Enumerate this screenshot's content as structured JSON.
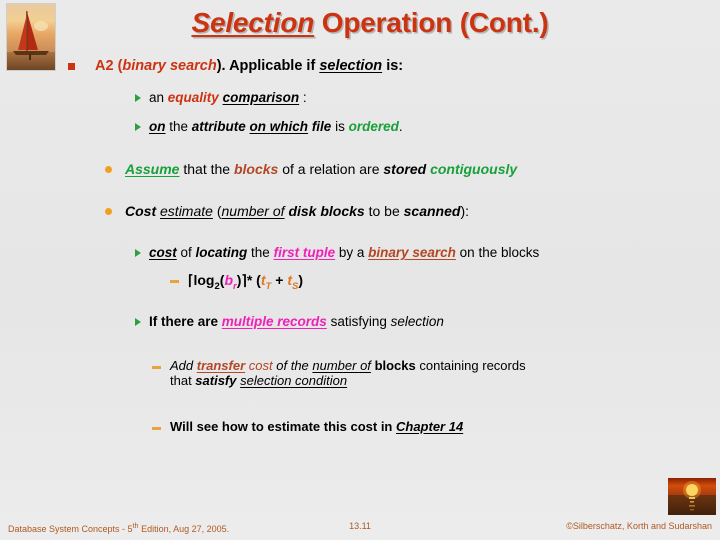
{
  "slide": {
    "title_italic": "Selection",
    "title_rest": " Operation (Cont.)",
    "title_full": "Selection Operation (Cont.)",
    "accent_red": "#cc3311",
    "accent_green": "#18a03a",
    "accent_orange": "#e07820",
    "accent_magenta": "#f020b8",
    "background": "#e8e8e8"
  },
  "content": {
    "a2_line": {
      "part1": "A2 (",
      "part2": "binary search",
      "part3": "). Applicable if ",
      "part4": "selection",
      "part5": " is:"
    },
    "sub1": {
      "part1": "an ",
      "part2": "equality",
      "part3": " ",
      "part4": "comparison",
      "part5": " :"
    },
    "sub2": {
      "part1": "on",
      "part2": " the ",
      "part3": "attribute",
      "part4": " ",
      "part5": "on which",
      "part6": " ",
      "part7": "file",
      "part8": " is ",
      "part9": "ordered",
      "part10": "."
    },
    "assume": {
      "part1": "Assume",
      "part2": " that the ",
      "part3": "blocks",
      "part4": " of a relation are ",
      "part5": "stored",
      "part6": " ",
      "part7": "contiguously"
    },
    "cost_estimate": {
      "part1": "Cost",
      "part2": " ",
      "part3": "estimate",
      "part4": " (",
      "part5": "number of",
      "part6": " ",
      "part7": "disk blocks",
      "part8": " to be ",
      "part9": "scanned",
      "part10": "):"
    },
    "cost_locating": {
      "part1": "cost",
      "part2": " of ",
      "part3": "locating",
      "part4": " the ",
      "part5": "first tuple",
      "part6": " by a ",
      "part7": "binary search",
      "part8": " on the blocks"
    },
    "formula": {
      "open_ceil": "⌈",
      "log": "log",
      "base": "2",
      "paren_open": "(",
      "var_b": "b",
      "var_b_sub": "r",
      "paren_close": ")",
      "close_ceil": "⌉",
      "times": "* (",
      "var_t1": "t",
      "var_t1_sub": "T",
      "plus": " + ",
      "var_t2": "t",
      "var_t2_sub": "S",
      "tail": ")",
      "plain": "⌈log2(br)⌉* (tT + tS)"
    },
    "multiple_records": {
      "part1": "If there are ",
      "part2": "multiple records",
      "part3": " satisfying ",
      "part4": "selection"
    },
    "add_transfer": {
      "part1": "Add ",
      "part2": "transfer",
      "part3": " ",
      "part4": "cost",
      "part5": "  of the ",
      "part6": "number of",
      "part7": " ",
      "part8": "blocks",
      "part9": " containing records",
      "line2_part1": "that ",
      "line2_part2": "satisfy",
      "line2_part3": " ",
      "line2_part4": "selection condition"
    },
    "chapter_ref": {
      "part1": "Will see how to estimate this cost in ",
      "part2": "Chapter 14"
    }
  },
  "footer": {
    "left_pre": "Database System Concepts - 5",
    "left_sup": "th",
    "left_post": " Edition, Aug 27, 2005.",
    "page": "13.11",
    "right": "©Silberschatz, Korth and Sudarshan"
  },
  "images": {
    "top_left": "sailboat-sunset-photo",
    "bottom_right": "sunset-over-water-photo"
  }
}
